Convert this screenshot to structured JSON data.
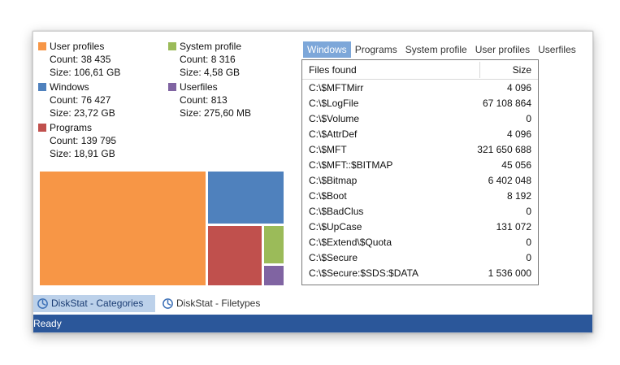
{
  "legend": {
    "categories": [
      {
        "name": "User profiles",
        "count": "Count: 38 435",
        "size": "Size: 106,61 GB",
        "color": "#f79646"
      },
      {
        "name": "Windows",
        "count": "Count: 76 427",
        "size": "Size: 23,72 GB",
        "color": "#4f81bd"
      },
      {
        "name": "Programs",
        "count": "Count: 139 795",
        "size": "Size: 18,91 GB",
        "color": "#c0504d"
      },
      {
        "name": "System profile",
        "count": "Count: 8 316",
        "size": "Size: 4,58 GB",
        "color": "#9bbb59"
      },
      {
        "name": "Userfiles",
        "count": "Count: 813",
        "size": "Size: 275,60 MB",
        "color": "#8064a2"
      }
    ]
  },
  "treemap": {
    "tiles": [
      {
        "category": "User profiles",
        "color": "#f79646"
      },
      {
        "category": "Windows",
        "color": "#4f81bd"
      },
      {
        "category": "Programs",
        "color": "#c0504d"
      },
      {
        "category": "System profile",
        "color": "#9bbb59"
      },
      {
        "category": "Userfiles",
        "color": "#8064a2"
      }
    ]
  },
  "tabs": [
    "Windows",
    "Programs",
    "System profile",
    "User profiles",
    "Userfiles"
  ],
  "active_tab": "Windows",
  "file_table": {
    "header_name": "Files found",
    "header_size": "Size",
    "rows": [
      {
        "name": "C:\\$MFTMirr",
        "size": "4 096"
      },
      {
        "name": "C:\\$LogFile",
        "size": "67 108 864"
      },
      {
        "name": "C:\\$Volume",
        "size": "0"
      },
      {
        "name": "C:\\$AttrDef",
        "size": "4 096"
      },
      {
        "name": "C:\\$MFT",
        "size": "321 650 688"
      },
      {
        "name": "C:\\$MFT::$BITMAP",
        "size": "45 056"
      },
      {
        "name": "C:\\$Bitmap",
        "size": "6 402 048"
      },
      {
        "name": "C:\\$Boot",
        "size": "8 192"
      },
      {
        "name": "C:\\$BadClus",
        "size": "0"
      },
      {
        "name": "C:\\$UpCase",
        "size": "131 072"
      },
      {
        "name": "C:\\$Extend\\$Quota",
        "size": "0"
      },
      {
        "name": "C:\\$Secure",
        "size": "0"
      },
      {
        "name": "C:\\$Secure:$SDS:$DATA",
        "size": "1 536 000"
      }
    ]
  },
  "bottom_tabs": [
    {
      "label": "DiskStat - Categories",
      "active": true
    },
    {
      "label": "DiskStat - Filetypes",
      "active": false
    }
  ],
  "status_bar": {
    "text": "Ready"
  },
  "colors": {
    "active_tab": "#7da7d9",
    "status_bar": "#2b579a",
    "bottom_tab_active": "#bcd1ea"
  }
}
